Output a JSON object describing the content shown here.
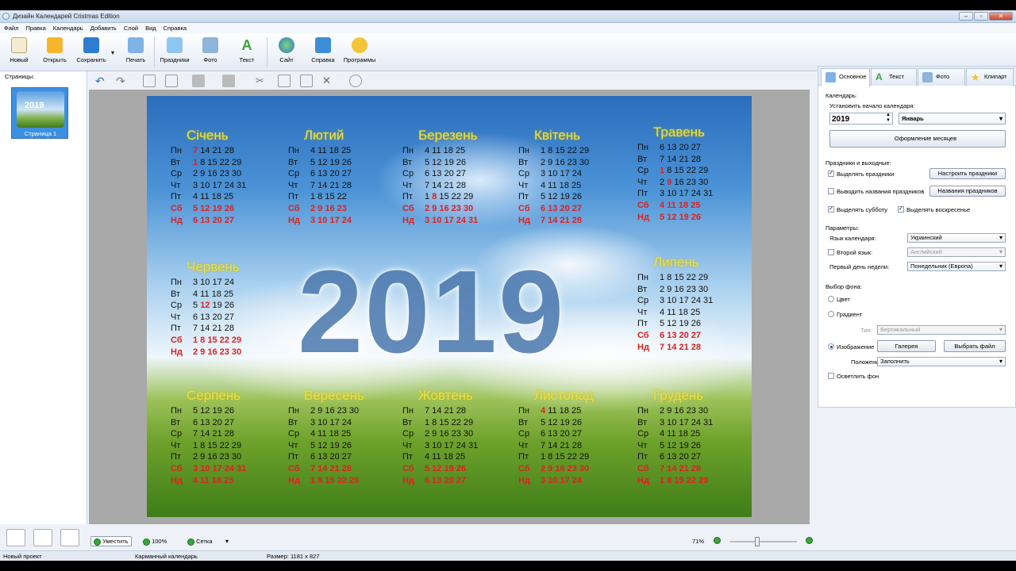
{
  "window": {
    "title": "Дизайн Календарей Cristmas Edition"
  },
  "menu": [
    "Файл",
    "Правка",
    "Календарь",
    "Добавить",
    "Слой",
    "Вид",
    "Справка"
  ],
  "toolbar": {
    "new": "Новый",
    "open": "Открыть",
    "save": "Сохранить",
    "print": "Печать",
    "holidays": "Праздники",
    "photo": "Фото",
    "text": "Текст",
    "site": "Сайт",
    "help": "Справка",
    "programs": "Программы"
  },
  "left_panel": {
    "header": "Страницы:",
    "thumb_text": "2019",
    "page_label": "Страница 1"
  },
  "calendar": {
    "year": "2019",
    "months": [
      {
        "name": "Січень",
        "rows": [
          {
            "day": "Пн",
            "nums": "7 14 21 28",
            "we": false,
            "red": "7"
          },
          {
            "day": "Вт",
            "nums": "1 8 15 22 29",
            "we": false,
            "red": "1"
          },
          {
            "day": "Ср",
            "nums": "2 9 16 23 30",
            "we": false
          },
          {
            "day": "Чт",
            "nums": "3 10 17 24 31",
            "we": false
          },
          {
            "day": "Пт",
            "nums": "4 11 18 25",
            "we": false
          },
          {
            "day": "Сб",
            "nums": "5 12 19 26",
            "we": true
          },
          {
            "day": "Нд",
            "nums": "6 13 20 27",
            "we": true
          }
        ]
      },
      {
        "name": "Лютий",
        "rows": [
          {
            "day": "Пн",
            "nums": "4 11 18 25",
            "we": false
          },
          {
            "day": "Вт",
            "nums": "5 12 19 26",
            "we": false
          },
          {
            "day": "Ср",
            "nums": "6 13 20 27",
            "we": false
          },
          {
            "day": "Чт",
            "nums": "7 14 21 28",
            "we": false
          },
          {
            "day": "Пт",
            "nums": "1 8 15 22",
            "we": false
          },
          {
            "day": "Сб",
            "nums": "2 9 16 23",
            "we": true
          },
          {
            "day": "Нд",
            "nums": "3 10 17 24",
            "we": true
          }
        ]
      },
      {
        "name": "Березень",
        "rows": [
          {
            "day": "Пн",
            "nums": "4 11 18 25",
            "we": false
          },
          {
            "day": "Вт",
            "nums": "5 12 19 26",
            "we": false
          },
          {
            "day": "Ср",
            "nums": "6 13 20 27",
            "we": false
          },
          {
            "day": "Чт",
            "nums": "7 14 21 28",
            "we": false
          },
          {
            "day": "Пт",
            "nums": "1 8 15 22 29",
            "we": false,
            "red": "8"
          },
          {
            "day": "Сб",
            "nums": "2 9 16 23 30",
            "we": true
          },
          {
            "day": "Нд",
            "nums": "3 10 17 24 31",
            "we": true
          }
        ]
      },
      {
        "name": "Квітень",
        "rows": [
          {
            "day": "Пн",
            "nums": "1 8 15 22 29",
            "we": false
          },
          {
            "day": "Вт",
            "nums": "2 9 16 23 30",
            "we": false
          },
          {
            "day": "Ср",
            "nums": "3 10 17 24",
            "we": false
          },
          {
            "day": "Чт",
            "nums": "4 11 18 25",
            "we": false
          },
          {
            "day": "Пт",
            "nums": "5 12 19 26",
            "we": false
          },
          {
            "day": "Сб",
            "nums": "6 13 20 27",
            "we": true
          },
          {
            "day": "Нд",
            "nums": "7 14 21 28",
            "we": true
          }
        ]
      },
      {
        "name": "Травень",
        "rows": [
          {
            "day": "Пн",
            "nums": "6 13 20 27",
            "we": false
          },
          {
            "day": "Вт",
            "nums": "7 14 21 28",
            "we": false
          },
          {
            "day": "Ср",
            "nums": "1 8 15 22 29",
            "we": false,
            "red": "1"
          },
          {
            "day": "Чт",
            "nums": "2 9 16 23 30",
            "we": false,
            "red": "9"
          },
          {
            "day": "Пт",
            "nums": "3 10 17 24 31",
            "we": false
          },
          {
            "day": "Сб",
            "nums": "4 11 18 25",
            "we": true
          },
          {
            "day": "Нд",
            "nums": "5 12 19 26",
            "we": true
          }
        ]
      },
      {
        "name": "Червень",
        "rows": [
          {
            "day": "Пн",
            "nums": "3 10 17 24",
            "we": false
          },
          {
            "day": "Вт",
            "nums": "4 11 18 25",
            "we": false
          },
          {
            "day": "Ср",
            "nums": "5 12 19 26",
            "we": false,
            "red": "12"
          },
          {
            "day": "Чт",
            "nums": "6 13 20 27",
            "we": false
          },
          {
            "day": "Пт",
            "nums": "7 14 21 28",
            "we": false
          },
          {
            "day": "Сб",
            "nums": "1 8 15 22 29",
            "we": true
          },
          {
            "day": "Нд",
            "nums": "2 9 16 23 30",
            "we": true
          }
        ]
      },
      {
        "name": "Липень",
        "rows": [
          {
            "day": "Пн",
            "nums": "1 8 15 22 29",
            "we": false
          },
          {
            "day": "Вт",
            "nums": "2 9 16 23 30",
            "we": false
          },
          {
            "day": "Ср",
            "nums": "3 10 17 24 31",
            "we": false
          },
          {
            "day": "Чт",
            "nums": "4 11 18 25",
            "we": false
          },
          {
            "day": "Пт",
            "nums": "5 12 19 26",
            "we": false
          },
          {
            "day": "Сб",
            "nums": "6 13 20 27",
            "we": true
          },
          {
            "day": "Нд",
            "nums": "7 14 21 28",
            "we": true
          }
        ]
      },
      {
        "name": "Серпень",
        "rows": [
          {
            "day": "Пн",
            "nums": "5 12 19 26",
            "we": false
          },
          {
            "day": "Вт",
            "nums": "6 13 20 27",
            "we": false
          },
          {
            "day": "Ср",
            "nums": "7 14 21 28",
            "we": false
          },
          {
            "day": "Чт",
            "nums": "1 8 15 22 29",
            "we": false
          },
          {
            "day": "Пт",
            "nums": "2 9 16 23 30",
            "we": false
          },
          {
            "day": "Сб",
            "nums": "3 10 17 24 31",
            "we": true
          },
          {
            "day": "Нд",
            "nums": "4 11 18 25",
            "we": true
          }
        ]
      },
      {
        "name": "Вересень",
        "rows": [
          {
            "day": "Пн",
            "nums": "2 9 16 23 30",
            "we": false
          },
          {
            "day": "Вт",
            "nums": "3 10 17 24",
            "we": false
          },
          {
            "day": "Ср",
            "nums": "4 11 18 25",
            "we": false
          },
          {
            "day": "Чт",
            "nums": "5 12 19 26",
            "we": false
          },
          {
            "day": "Пт",
            "nums": "6 13 20 27",
            "we": false
          },
          {
            "day": "Сб",
            "nums": "7 14 21 28",
            "we": true
          },
          {
            "day": "Нд",
            "nums": "1 8 15 22 29",
            "we": true
          }
        ]
      },
      {
        "name": "Жовтень",
        "rows": [
          {
            "day": "Пн",
            "nums": "7 14 21 28",
            "we": false
          },
          {
            "day": "Вт",
            "nums": "1 8 15 22 29",
            "we": false
          },
          {
            "day": "Ср",
            "nums": "2 9 16 23 30",
            "we": false
          },
          {
            "day": "Чт",
            "nums": "3 10 17 24 31",
            "we": false
          },
          {
            "day": "Пт",
            "nums": "4 11 18 25",
            "we": false
          },
          {
            "day": "Сб",
            "nums": "5 12 19 26",
            "we": true
          },
          {
            "day": "Нд",
            "nums": "6 13 20 27",
            "we": true
          }
        ]
      },
      {
        "name": "Листопад",
        "rows": [
          {
            "day": "Пн",
            "nums": "4 11 18 25",
            "we": false,
            "red": "4"
          },
          {
            "day": "Вт",
            "nums": "5 12 19 26",
            "we": false
          },
          {
            "day": "Ср",
            "nums": "6 13 20 27",
            "we": false
          },
          {
            "day": "Чт",
            "nums": "7 14 21 28",
            "we": false
          },
          {
            "day": "Пт",
            "nums": "1 8 15 22 29",
            "we": false
          },
          {
            "day": "Сб",
            "nums": "2 9 16 23 30",
            "we": true
          },
          {
            "day": "Нд",
            "nums": "3 10 17 24",
            "we": true
          }
        ]
      },
      {
        "name": "Грудень",
        "rows": [
          {
            "day": "Пн",
            "nums": "2 9 16 23 30",
            "we": false
          },
          {
            "day": "Вт",
            "nums": "3 10 17 24 31",
            "we": false
          },
          {
            "day": "Ср",
            "nums": "4 11 18 25",
            "we": false
          },
          {
            "day": "Чт",
            "nums": "5 12 19 26",
            "we": false
          },
          {
            "day": "Пт",
            "nums": "6 13 20 27",
            "we": false
          },
          {
            "day": "Сб",
            "nums": "7 14 21 28",
            "we": true
          },
          {
            "day": "Нд",
            "nums": "1 8 15 22 29",
            "we": true
          }
        ]
      }
    ]
  },
  "right_panel": {
    "tabs": [
      "Основное",
      "Текст",
      "Фото",
      "Клипарт"
    ],
    "calendar_label": "Календарь:",
    "start_label": "Установить начало календаря:",
    "year_value": "2019",
    "month_value": "Январь",
    "months_design_btn": "Оформление месяцев",
    "holidays_label": "Праздники и выходные:",
    "highlight_holidays": "Выделять праздники",
    "setup_holidays_btn": "Настроить праздники",
    "show_holiday_names": "Выводить названия праздников",
    "holiday_names_btn": "Названия праздников",
    "highlight_saturday": "Выделять субботу",
    "highlight_sunday": "Выделять воскресенье",
    "params_label": "Параметры:",
    "lang_label": "Язык календаря:",
    "lang_value": "Украинский",
    "second_lang_label": "Второй язык:",
    "second_lang_value": "Английский",
    "first_day_label": "Первый день недели:",
    "first_day_value": "Понедельник (Европа)",
    "bg_label": "Выбор фона:",
    "bg_color": "Цвет",
    "bg_gradient": "Градиент",
    "type_label": "Тип:",
    "type_value": "Вертикальный",
    "bg_image": "Изображение",
    "gallery_btn": "Галерея",
    "choose_file_btn": "Выбрать файл",
    "position_label": "Положение:",
    "position_value": "Заполнить",
    "lighten_bg": "Осветлить фон"
  },
  "bottom": {
    "fit": "Уместить",
    "zoom100": "100%",
    "grid": "Сетка",
    "zoom_level": "71%",
    "zoom_slider_fraction": 0.4
  },
  "status": {
    "project": "Новый проект",
    "type": "Карманный календарь",
    "size": "Размер: 1181 x 827"
  }
}
